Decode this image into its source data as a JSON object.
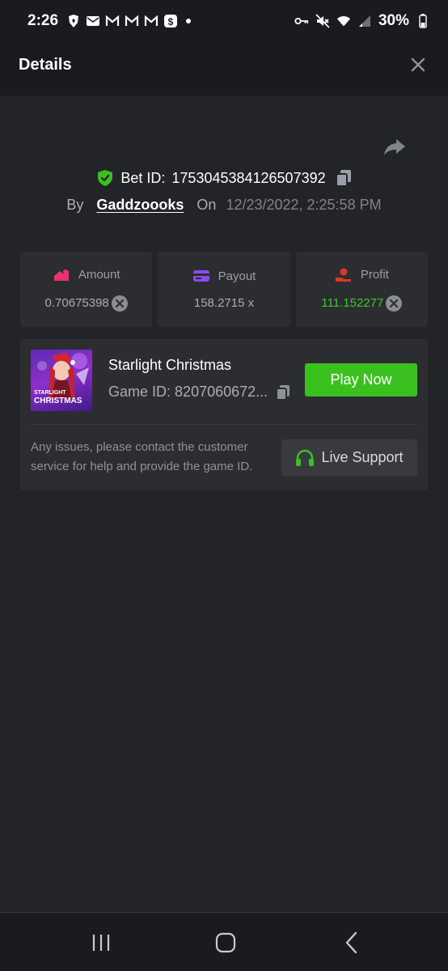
{
  "status_bar": {
    "time": "2:26",
    "battery": "30%",
    "left_icons": [
      "brave-icon",
      "mail-icon",
      "gmail-icon",
      "gmail-icon",
      "gmail-icon",
      "cashapp-icon"
    ],
    "right_icons": [
      "key-icon",
      "mute-icon",
      "wifi-icon",
      "signal-icon",
      "battery-icon"
    ]
  },
  "header": {
    "title": "Details"
  },
  "bet": {
    "id_label": "Bet ID:",
    "id": "1753045384126507392",
    "by_label": "By",
    "user": "Gaddzoooks",
    "on_label": "On",
    "date": "12/23/2022, 2:25:58 PM"
  },
  "stats": [
    {
      "label": "Amount",
      "value": "0.70675398",
      "icon": "amount-icon",
      "color": "#e8336b"
    },
    {
      "label": "Payout",
      "value": "158.2715 x",
      "icon": "card-icon",
      "color": "#8a4cf0"
    },
    {
      "label": "Profit",
      "value": "111.152277",
      "icon": "profit-icon",
      "color": "#e0352b"
    }
  ],
  "game": {
    "name": "Starlight Christmas",
    "id_label": "Game ID:",
    "id": "8207060672...",
    "thumb_text_1": "STARLIGHT",
    "thumb_text_2": "CHRISTMAS",
    "play_label": "Play Now",
    "help_text": "Any issues, please contact the customer service for help and provide the game ID.",
    "support_label": "Live Support"
  },
  "colors": {
    "background": "#232427",
    "card": "#2c2d31",
    "accent_green": "#3bc11f",
    "profit_green": "#3dc82a"
  }
}
